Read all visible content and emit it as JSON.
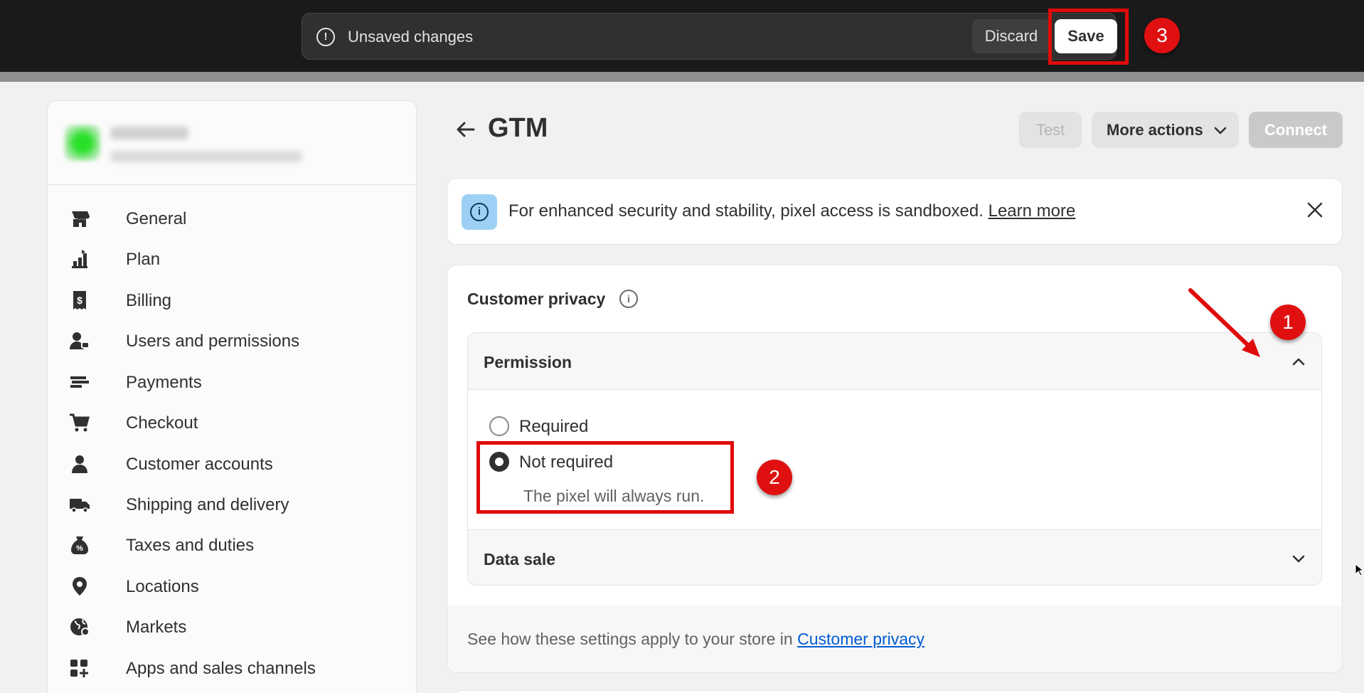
{
  "savebar": {
    "message": "Unsaved changes",
    "discard_label": "Discard",
    "save_label": "Save",
    "warning_icon": "alert-circle-icon"
  },
  "annotations": {
    "step1": "1",
    "step2": "2",
    "step3": "3",
    "accent": "#e00b0b"
  },
  "sidebar": {
    "items": [
      {
        "label": "General",
        "icon": "store-icon"
      },
      {
        "label": "Plan",
        "icon": "plan-icon"
      },
      {
        "label": "Billing",
        "icon": "billing-icon"
      },
      {
        "label": "Users and permissions",
        "icon": "users-icon"
      },
      {
        "label": "Payments",
        "icon": "payments-icon"
      },
      {
        "label": "Checkout",
        "icon": "cart-icon"
      },
      {
        "label": "Customer accounts",
        "icon": "person-icon"
      },
      {
        "label": "Shipping and delivery",
        "icon": "truck-icon"
      },
      {
        "label": "Taxes and duties",
        "icon": "tax-icon"
      },
      {
        "label": "Locations",
        "icon": "location-pin-icon"
      },
      {
        "label": "Markets",
        "icon": "globe-icon"
      },
      {
        "label": "Apps and sales channels",
        "icon": "apps-icon"
      }
    ]
  },
  "page": {
    "title": "GTM",
    "test_label": "Test",
    "more_actions_label": "More actions",
    "connect_label": "Connect"
  },
  "banner": {
    "text": "For enhanced security and stability, pixel access is sandboxed.",
    "link": "Learn more"
  },
  "privacy": {
    "title": "Customer privacy",
    "permission_label": "Permission",
    "options": [
      {
        "label": "Required",
        "checked": false
      },
      {
        "label": "Not required",
        "checked": true
      }
    ],
    "help_text": "The pixel will always run.",
    "data_sale_label": "Data sale",
    "footer_text": "See how these settings apply to your store in",
    "footer_link": "Customer privacy"
  }
}
